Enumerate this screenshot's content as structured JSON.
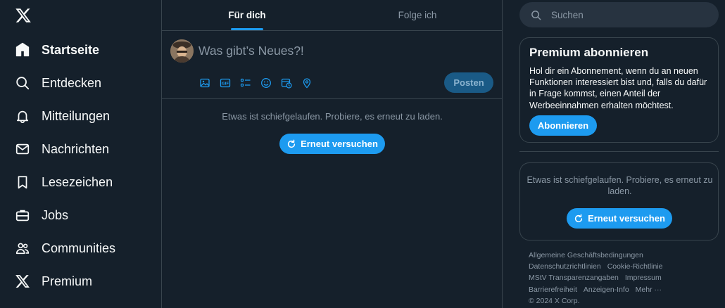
{
  "nav": {
    "items": [
      {
        "label": "Startseite",
        "icon": "home-icon"
      },
      {
        "label": "Entdecken",
        "icon": "search-icon"
      },
      {
        "label": "Mitteilungen",
        "icon": "bell-icon"
      },
      {
        "label": "Nachrichten",
        "icon": "envelope-icon"
      },
      {
        "label": "Lesezeichen",
        "icon": "bookmark-icon"
      },
      {
        "label": "Jobs",
        "icon": "briefcase-icon"
      },
      {
        "label": "Communities",
        "icon": "people-icon"
      },
      {
        "label": "Premium",
        "icon": "x-logo-icon"
      }
    ]
  },
  "tabs": {
    "for_you": "Für dich",
    "following": "Folge ich"
  },
  "composer": {
    "placeholder": "Was gibt’s Neues?!",
    "post_label": "Posten",
    "tools": [
      "image-icon",
      "gif-icon",
      "poll-icon",
      "emoji-icon",
      "schedule-icon",
      "location-icon"
    ]
  },
  "feed": {
    "error": "Etwas ist schiefgelaufen. Probiere, es erneut zu laden.",
    "retry_label": "Erneut versuchen"
  },
  "search": {
    "placeholder": "Suchen"
  },
  "premium": {
    "title": "Premium abonnieren",
    "text": "Hol dir ein Abonnement, wenn du an neuen Funktionen interessiert bist und, falls du dafür in Frage kommst, einen Anteil der Werbeeinnahmen erhalten möchtest.",
    "button_label": "Abonnieren"
  },
  "trends": {
    "error": "Etwas ist schiefgelaufen. Probiere, es erneut zu laden.",
    "retry_label": "Erneut versuchen"
  },
  "footer": {
    "terms": "Allgemeine Geschäftsbedingungen",
    "privacy": "Datenschutzrichtlinien",
    "cookies": "Cookie-Richtlinie",
    "mstv": "MStV Transparenzangaben",
    "imprint": "Impressum",
    "accessibility": "Barrierefreiheit",
    "ads_info": "Anzeigen-Info",
    "more": "Mehr ···",
    "copyright": "© 2024 X Corp."
  },
  "colors": {
    "background": "#15202b",
    "accent": "#1d9bf0",
    "border": "#38444d",
    "muted_text": "#8b98a5"
  }
}
